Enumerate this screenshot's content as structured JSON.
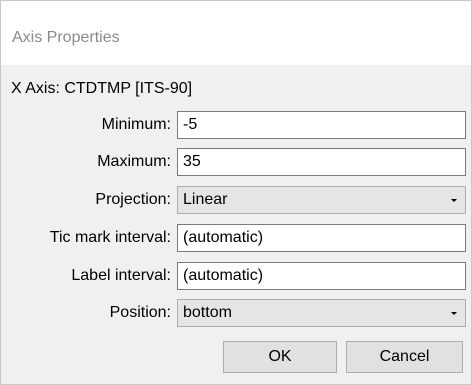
{
  "window": {
    "title": "Axis Properties"
  },
  "axis_header": "X Axis: CTDTMP [ITS-90]",
  "fields": {
    "minimum": {
      "label": "Minimum:",
      "value": "-5"
    },
    "maximum": {
      "label": "Maximum:",
      "value": "35"
    },
    "projection": {
      "label": "Projection:",
      "value": "Linear"
    },
    "tic_interval": {
      "label": "Tic mark interval:",
      "value": "(automatic)"
    },
    "label_interval": {
      "label": "Label interval:",
      "value": "(automatic)"
    },
    "position": {
      "label": "Position:",
      "value": "bottom"
    }
  },
  "buttons": {
    "ok": "OK",
    "cancel": "Cancel"
  },
  "icons": {
    "dropdown": "chevron-down-icon"
  },
  "colors": {
    "dialog_bg": "#f0f0f0",
    "title_text": "#8a8a8a",
    "button_bg": "#e1e1e1",
    "combo_bg": "#e5e5e5"
  }
}
